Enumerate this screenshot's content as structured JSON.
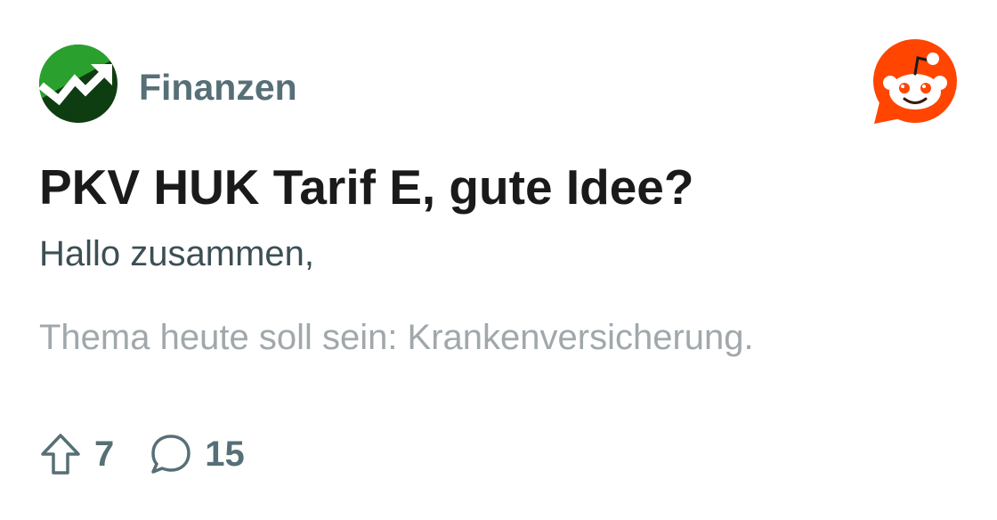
{
  "subreddit": {
    "name": "Finanzen",
    "icon": "trend-up-icon",
    "icon_colors": {
      "bg_light": "#2aa12e",
      "bg_dark": "#0f3d12",
      "arrow": "#ffffff"
    }
  },
  "brand": {
    "icon": "reddit-logo-icon",
    "color": "#ff4500"
  },
  "post": {
    "title": "PKV HUK Tarif E, gute Idee?",
    "body_line1": "Hallo zusammen,",
    "body_line2": "Thema heute soll sein: Krankenversicherung."
  },
  "stats": {
    "upvotes": "7",
    "comments": "15",
    "upvote_icon": "upvote-arrow-icon",
    "comment_icon": "comment-bubble-icon"
  }
}
